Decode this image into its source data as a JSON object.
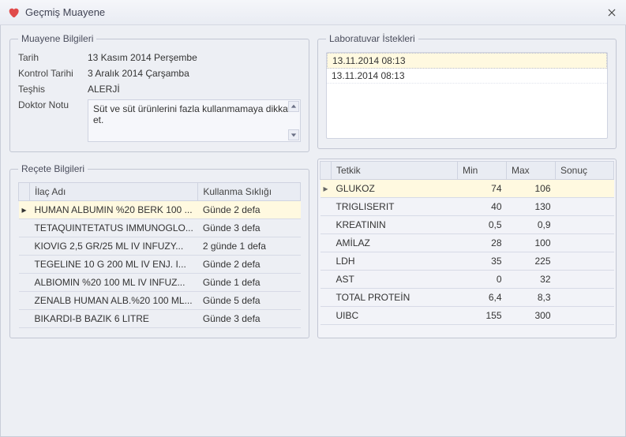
{
  "window": {
    "title": "Geçmiş Muayene"
  },
  "exam_info": {
    "legend": "Muayene Bilgileri",
    "labels": {
      "date": "Tarih",
      "control_date": "Kontrol Tarihi",
      "diagnosis": "Teşhis",
      "doctor_note": "Doktor Notu"
    },
    "values": {
      "date": "13 Kasım 2014 Perşembe",
      "control_date": "3 Aralık 2014 Çarşamba",
      "diagnosis": "ALERJİ",
      "doctor_note": "Süt ve süt ürünlerini fazla kullanmamaya dikkat et."
    }
  },
  "rx": {
    "legend": "Reçete Bilgileri",
    "columns": {
      "drug": "İlaç Adı",
      "frequency": "Kullanma Sıklığı"
    },
    "rows": [
      {
        "drug": "HUMAN ALBUMIN %20 BERK 100 ...",
        "frequency": "Günde 2 defa",
        "selected": true
      },
      {
        "drug": "TETAQUINTETATUS IMMUNOGLO...",
        "frequency": "Günde 3 defa"
      },
      {
        "drug": "KIOVIG 2,5 GR/25 ML IV INFUZY...",
        "frequency": "2 günde 1 defa"
      },
      {
        "drug": "TEGELINE 10 G 200 ML  IV ENJ. I...",
        "frequency": "Günde 2 defa"
      },
      {
        "drug": "ALBIOMIN %20 100 ML IV INFUZ...",
        "frequency": "Günde 1 defa"
      },
      {
        "drug": "ZENALB HUMAN ALB.%20 100 ML...",
        "frequency": "Günde 5 defa"
      },
      {
        "drug": "BIKARDI-B BAZIK 6 LITRE",
        "frequency": "Günde 3 defa"
      }
    ]
  },
  "lab_requests": {
    "legend": "Laboratuvar İstekleri",
    "items": [
      {
        "label": "13.11.2014 08:13",
        "selected": true
      },
      {
        "label": "13.11.2014 08:13"
      }
    ]
  },
  "results": {
    "columns": {
      "test": "Tetkik",
      "min": "Min",
      "max": "Max",
      "result": "Sonuç"
    },
    "rows": [
      {
        "test": "GLUKOZ",
        "min": "74",
        "max": "106",
        "selected": true
      },
      {
        "test": "TRIGLISERIT",
        "min": "40",
        "max": "130"
      },
      {
        "test": "KREATININ",
        "min": "0,5",
        "max": "0,9"
      },
      {
        "test": "AMİLAZ",
        "min": "28",
        "max": "100"
      },
      {
        "test": "LDH",
        "min": "35",
        "max": "225"
      },
      {
        "test": "AST",
        "min": "0",
        "max": "32"
      },
      {
        "test": "TOTAL PROTEİN",
        "min": "6,4",
        "max": "8,3"
      },
      {
        "test": "UIBC",
        "min": "155",
        "max": "300"
      }
    ]
  }
}
